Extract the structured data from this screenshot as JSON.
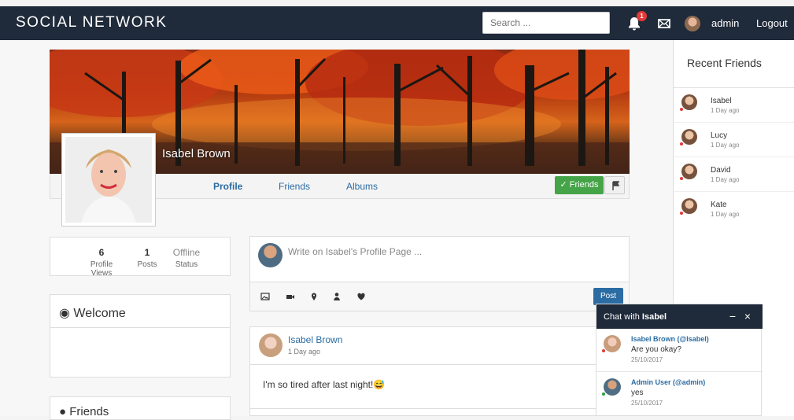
{
  "app": {
    "brand": "SOCIAL NETWORK",
    "search_placeholder": "Search ...",
    "notification_count": "1",
    "username": "admin",
    "logout": "Logout"
  },
  "profile": {
    "name": "Isabel Brown",
    "tabs": [
      "Profile",
      "Friends",
      "Albums"
    ],
    "friends_button": "✓ Friends"
  },
  "stats": [
    {
      "value": "6",
      "label": "Profile Views"
    },
    {
      "value": "1",
      "label": "Posts"
    },
    {
      "value": "Offline",
      "label": "Status"
    }
  ],
  "welcome": {
    "title": "Welcome"
  },
  "friends_panel": {
    "title": "Friends"
  },
  "composer": {
    "placeholder": "Write on Isabel's Profile Page ...",
    "post_button": "Post"
  },
  "post": {
    "author": "Isabel Brown",
    "time": "1 Day ago",
    "text": "I'm so tired after last night!😅"
  },
  "sidebar": {
    "title": "Recent Friends",
    "friends": [
      {
        "name": "Isabel",
        "time": "1 Day ago"
      },
      {
        "name": "Lucy",
        "time": "1 Day ago"
      },
      {
        "name": "David",
        "time": "1 Day ago"
      },
      {
        "name": "Kate",
        "time": "1 Day ago"
      }
    ]
  },
  "chat": {
    "title_prefix": "Chat with",
    "title_name": "Isabel",
    "minimize": "−",
    "close": "×",
    "messages": [
      {
        "user": "Isabel Brown (@Isabel)",
        "text": "Are you okay?",
        "date": "25/10/2017"
      },
      {
        "user": "Admin User (@admin)",
        "text": "yes",
        "date": "25/10/2017"
      }
    ]
  },
  "colors": {
    "navbar": "#1f2a3a",
    "link": "#2b6ca3",
    "friends_button": "#45a348",
    "notification": "#e53935"
  }
}
